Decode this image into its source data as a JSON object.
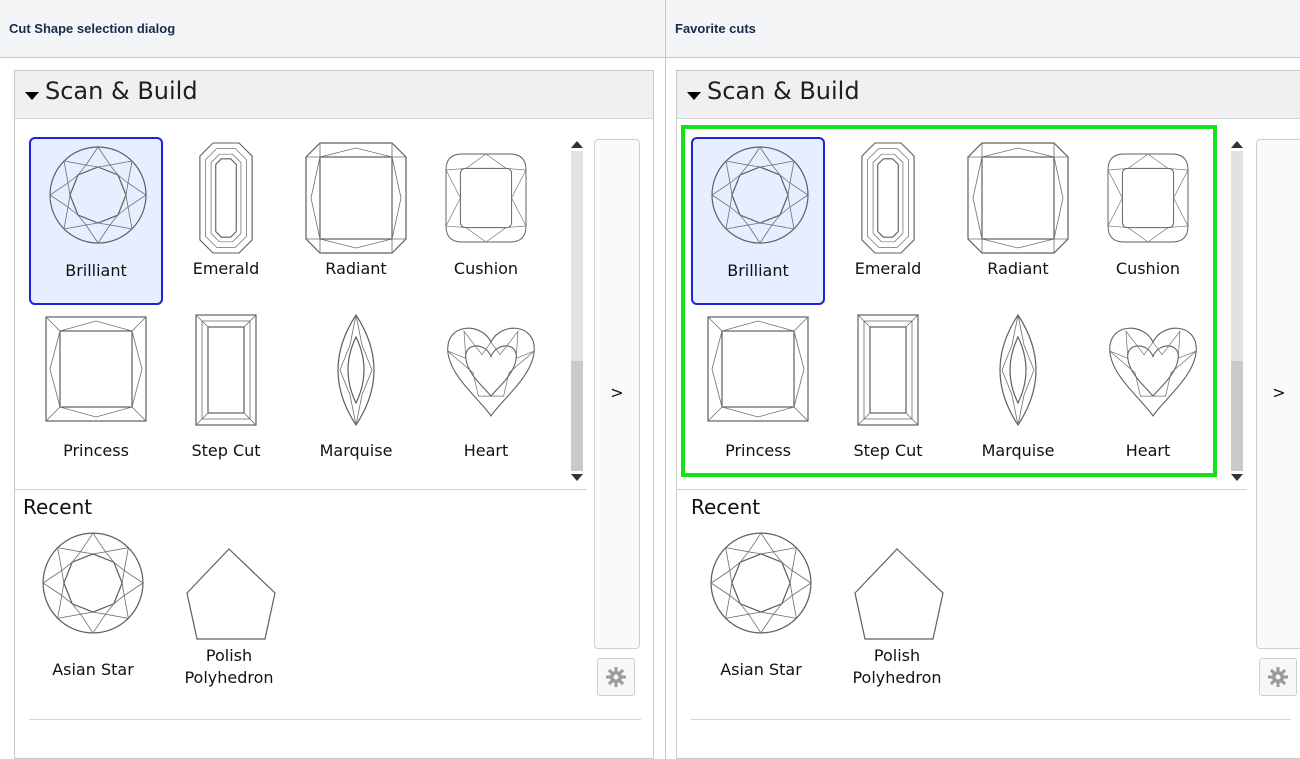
{
  "columns": [
    {
      "header": "Cut Shape selection dialog"
    },
    {
      "header": "Favorite cuts"
    }
  ],
  "dialog": {
    "section_title": "Scan & Build",
    "cuts": [
      {
        "label": "Brilliant",
        "icon": "round-brilliant-icon",
        "selected": true
      },
      {
        "label": "Emerald",
        "icon": "emerald-cut-icon"
      },
      {
        "label": "Radiant",
        "icon": "radiant-cut-icon"
      },
      {
        "label": "Cushion",
        "icon": "cushion-cut-icon"
      },
      {
        "label": "Princess",
        "icon": "princess-cut-icon"
      },
      {
        "label": "Step Cut",
        "icon": "step-cut-icon"
      },
      {
        "label": "Marquise",
        "icon": "marquise-cut-icon"
      },
      {
        "label": "Heart",
        "icon": "heart-cut-icon"
      }
    ],
    "recent_title": "Recent",
    "recent": [
      {
        "label": "Asian Star",
        "icon": "asian-star-icon"
      },
      {
        "label_line1": "Polish",
        "label_line2": "Polyhedron",
        "icon": "polyhedron-icon"
      }
    ],
    "expand_label": ">",
    "settings_icon": "gear-icon"
  },
  "colors": {
    "selection_border": "#1c24d6",
    "selection_fill": "#e6efff",
    "favorites_highlight": "#16e016"
  }
}
